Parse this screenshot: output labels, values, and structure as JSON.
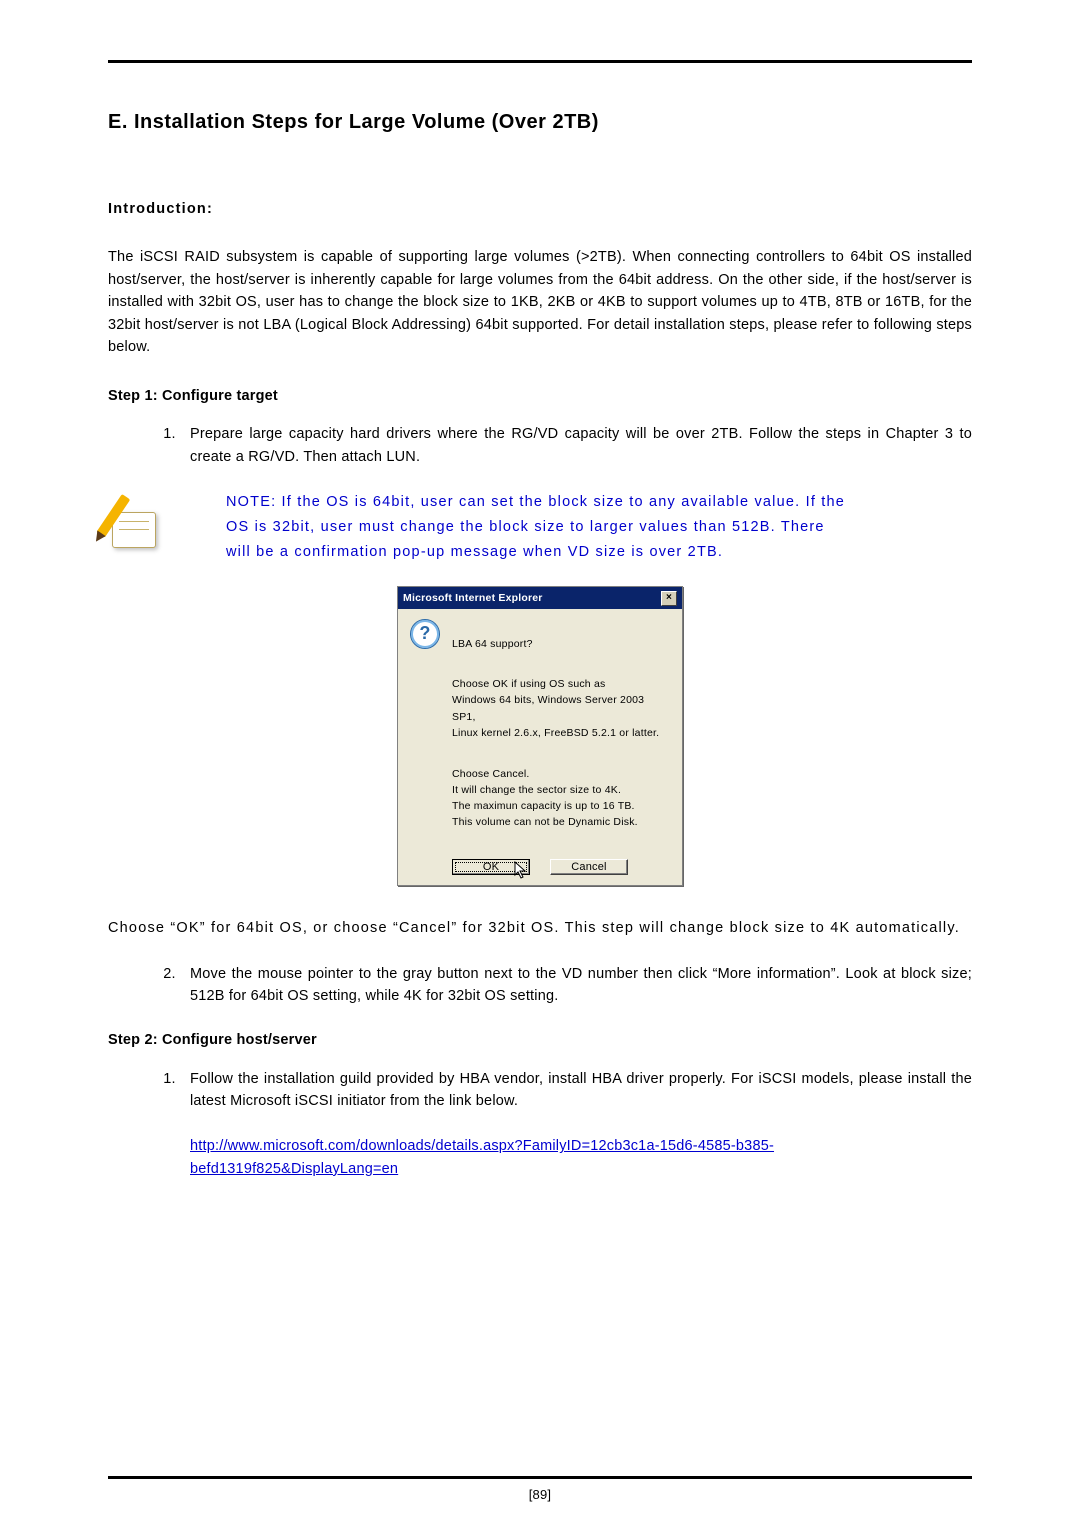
{
  "section": {
    "heading": "E.   Installation Steps for Large Volume (Over 2TB)"
  },
  "intro": {
    "label": "Introduction:",
    "body": "The iSCSI RAID subsystem is capable of supporting large volumes (>2TB). When connecting controllers to 64bit OS installed host/server, the host/server is inherently capable for large volumes from the 64bit address. On the other side, if the host/server is installed with 32bit OS, user has to change the block size to 1KB, 2KB or 4KB to support volumes up to 4TB, 8TB or 16TB, for the 32bit host/server is not LBA (Logical Block Addressing) 64bit supported. For detail installation steps, please refer to following steps below."
  },
  "step1": {
    "label": "Step 1: Configure target",
    "items": [
      "Prepare large capacity hard drivers where the RG/VD capacity will be over 2TB. Follow the steps in Chapter 3 to create a RG/VD. Then attach LUN.",
      "Move the mouse pointer to the gray button next to the VD number then click “More information”. Look at block size; 512B for 64bit OS setting, while 4K for 32bit OS setting."
    ]
  },
  "note": {
    "text": "NOTE: If the OS is 64bit, user can set the block size to any available value. If the OS is 32bit, user must change the block size to larger values than 512B. There will be a confirmation pop-up message when VD size is over 2TB."
  },
  "dialog": {
    "title": "Microsoft Internet Explorer",
    "close": "×",
    "question_glyph": "?",
    "msg_line1": "LBA 64 support?",
    "msg_block1": "Choose OK if using OS such as\nWindows 64 bits, Windows Server 2003 SP1,\nLinux kernel 2.6.x, FreeBSD 5.2.1 or latter.",
    "msg_block2": "Choose Cancel.\nIt will change the sector size to 4K.\nThe maximun capacity is up to 16 TB.\nThis volume can not be Dynamic Disk.",
    "ok": "OK",
    "cancel": "Cancel"
  },
  "after_dialog": "Choose “OK” for 64bit OS, or choose “Cancel” for 32bit OS. This step will change block size to 4K automatically.",
  "step2": {
    "label": "Step 2: Configure host/server",
    "items": [
      "Follow the installation guild provided by HBA vendor, install HBA driver properly. For iSCSI models, please install the latest Microsoft iSCSI initiator from the link below."
    ],
    "link": "http://www.microsoft.com/downloads/details.aspx?FamilyID=12cb3c1a-15d6-4585-b385-befd1319f825&DisplayLang=en"
  },
  "page_number": "[89]"
}
